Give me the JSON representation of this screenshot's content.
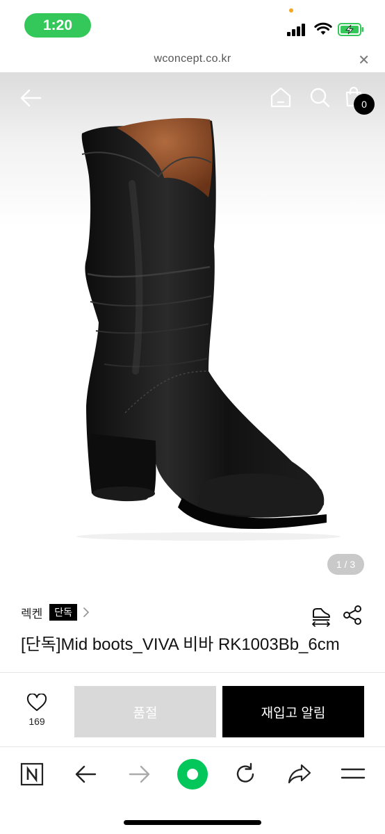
{
  "status_bar": {
    "time": "1:20"
  },
  "browser": {
    "url": "wconcept.co.kr",
    "close_label": "✕"
  },
  "gallery": {
    "cart_count": "0",
    "page_indicator": "1 / 3"
  },
  "product": {
    "brand": "렉켄",
    "exclusive_tag": "단독",
    "title": "[단독]Mid boots_VIVA 비바 RK1003Bb_6cm"
  },
  "purchase": {
    "like_count": "169",
    "soldout_label": "품절",
    "restock_label": "재입고 알림"
  },
  "colors": {
    "status_green": "#34c759",
    "toolbar_green": "#03c75a"
  }
}
